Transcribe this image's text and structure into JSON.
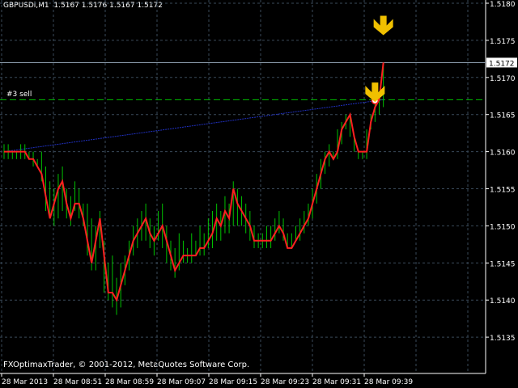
{
  "header": {
    "symbol": "GBPUSDi,M1",
    "ohlc": "1.5167 1.5176 1.5167 1.5172"
  },
  "order_label": "#3 sell",
  "copyright": "FXOptimaxTrader, © 2001-2012, MetaQuotes Software Corp.",
  "colors": {
    "background": "#000000",
    "grid": "#3a4a5a",
    "bars": "#00c000",
    "ma_line": "#ff2020",
    "trend_line": "#2030c0",
    "order_line": "#00c000",
    "bid_line": "#8a9aaa",
    "arrows": "#f0c000",
    "axis_text": "#ffffff"
  },
  "chart_data": {
    "type": "line",
    "ylim": [
      1.513,
      1.518
    ],
    "y_ticks": [
      "1.5180",
      "1.5175",
      "1.5170",
      "1.5165",
      "1.5160",
      "1.5155",
      "1.5150",
      "1.5145",
      "1.5140",
      "1.5135"
    ],
    "x_ticks": [
      "28 Mar 2013",
      "28 Mar 08:51",
      "28 Mar 08:59",
      "28 Mar 09:07",
      "28 Mar 09:15",
      "28 Mar 09:23",
      "28 Mar 09:31",
      "28 Mar 09:39"
    ],
    "current_price": "1.5172",
    "sell_order_price": 1.5167,
    "bars": [
      [
        1.5161,
        1.5159
      ],
      [
        1.5161,
        1.5159
      ],
      [
        1.516,
        1.5159
      ],
      [
        1.516,
        1.5159
      ],
      [
        1.5161,
        1.5159
      ],
      [
        1.5161,
        1.5159
      ],
      [
        1.516,
        1.5159
      ],
      [
        1.516,
        1.5158
      ],
      [
        1.5159,
        1.5158
      ],
      [
        1.516,
        1.5156
      ],
      [
        1.5158,
        1.5152
      ],
      [
        1.5156,
        1.5151
      ],
      [
        1.5155,
        1.515
      ],
      [
        1.5157,
        1.5151
      ],
      [
        1.5158,
        1.5152
      ],
      [
        1.5155,
        1.5151
      ],
      [
        1.5154,
        1.515
      ],
      [
        1.5156,
        1.5152
      ],
      [
        1.5155,
        1.5151
      ],
      [
        1.5153,
        1.515
      ],
      [
        1.5153,
        1.5146
      ],
      [
        1.5151,
        1.5144
      ],
      [
        1.515,
        1.5144
      ],
      [
        1.5152,
        1.5147
      ],
      [
        1.5148,
        1.5141
      ],
      [
        1.5145,
        1.514
      ],
      [
        1.5146,
        1.5139
      ],
      [
        1.5143,
        1.5138
      ],
      [
        1.5145,
        1.5139
      ],
      [
        1.5146,
        1.5142
      ],
      [
        1.5148,
        1.5144
      ],
      [
        1.515,
        1.5146
      ],
      [
        1.5151,
        1.5147
      ],
      [
        1.5152,
        1.5148
      ],
      [
        1.5153,
        1.5148
      ],
      [
        1.5151,
        1.5147
      ],
      [
        1.515,
        1.5146
      ],
      [
        1.5152,
        1.5148
      ],
      [
        1.5153,
        1.5147
      ],
      [
        1.515,
        1.5145
      ],
      [
        1.5148,
        1.5144
      ],
      [
        1.5147,
        1.5143
      ],
      [
        1.5149,
        1.5144
      ],
      [
        1.5148,
        1.5145
      ],
      [
        1.5147,
        1.5145
      ],
      [
        1.5149,
        1.5145
      ],
      [
        1.5148,
        1.5146
      ],
      [
        1.515,
        1.5146
      ],
      [
        1.5149,
        1.5146
      ],
      [
        1.5151,
        1.5147
      ],
      [
        1.5152,
        1.5147
      ],
      [
        1.5153,
        1.5148
      ],
      [
        1.5152,
        1.5148
      ],
      [
        1.5154,
        1.5149
      ],
      [
        1.5153,
        1.5149
      ],
      [
        1.5156,
        1.515
      ],
      [
        1.5155,
        1.515
      ],
      [
        1.5154,
        1.515
      ],
      [
        1.5153,
        1.5149
      ],
      [
        1.5152,
        1.5148
      ],
      [
        1.515,
        1.5147
      ],
      [
        1.5149,
        1.5147
      ],
      [
        1.5149,
        1.5147
      ],
      [
        1.515,
        1.5147
      ],
      [
        1.515,
        1.5147
      ],
      [
        1.5151,
        1.5148
      ],
      [
        1.5152,
        1.5149
      ],
      [
        1.5151,
        1.5148
      ],
      [
        1.5149,
        1.5147
      ],
      [
        1.5149,
        1.5147
      ],
      [
        1.515,
        1.5148
      ],
      [
        1.5151,
        1.5148
      ],
      [
        1.5152,
        1.5149
      ],
      [
        1.5153,
        1.515
      ],
      [
        1.5155,
        1.5151
      ],
      [
        1.5157,
        1.5153
      ],
      [
        1.5159,
        1.5155
      ],
      [
        1.516,
        1.5157
      ],
      [
        1.5161,
        1.5158
      ],
      [
        1.516,
        1.5159
      ],
      [
        1.5163,
        1.5159
      ],
      [
        1.5164,
        1.5161
      ],
      [
        1.5165,
        1.5163
      ],
      [
        1.5165,
        1.5162
      ],
      [
        1.5162,
        1.516
      ],
      [
        1.516,
        1.5159
      ],
      [
        1.516,
        1.5159
      ],
      [
        1.5163,
        1.5159
      ],
      [
        1.5165,
        1.5163
      ],
      [
        1.5167,
        1.5164
      ],
      [
        1.5168,
        1.5165
      ],
      [
        1.5172,
        1.5166
      ]
    ],
    "ma": [
      1.516,
      1.516,
      1.516,
      1.516,
      1.516,
      1.516,
      1.5159,
      1.5159,
      1.5158,
      1.5157,
      1.5154,
      1.5151,
      1.5153,
      1.5155,
      1.5156,
      1.5153,
      1.5151,
      1.5153,
      1.5153,
      1.5151,
      1.5148,
      1.5145,
      1.5148,
      1.5151,
      1.5146,
      1.5141,
      1.5141,
      1.514,
      1.5142,
      1.5144,
      1.5146,
      1.5148,
      1.5149,
      1.515,
      1.5151,
      1.5149,
      1.5148,
      1.5149,
      1.515,
      1.5148,
      1.5146,
      1.5144,
      1.5145,
      1.5146,
      1.5146,
      1.5146,
      1.5146,
      1.5147,
      1.5147,
      1.5148,
      1.5149,
      1.5151,
      1.515,
      1.5152,
      1.5151,
      1.5155,
      1.5153,
      1.5152,
      1.5151,
      1.515,
      1.5148,
      1.5148,
      1.5148,
      1.5148,
      1.5148,
      1.5149,
      1.515,
      1.5149,
      1.5147,
      1.5147,
      1.5148,
      1.5149,
      1.515,
      1.5151,
      1.5153,
      1.5155,
      1.5157,
      1.5159,
      1.516,
      1.5159,
      1.516,
      1.5163,
      1.5164,
      1.5165,
      1.5162,
      1.516,
      1.516,
      1.516,
      1.5164,
      1.5166,
      1.5167,
      1.5172
    ],
    "trend_line": [
      [
        0,
        1.516
      ],
      [
        91,
        1.5167
      ]
    ],
    "down_arrows": [
      [
        91,
        1.5177
      ],
      [
        89,
        1.5168
      ]
    ]
  }
}
